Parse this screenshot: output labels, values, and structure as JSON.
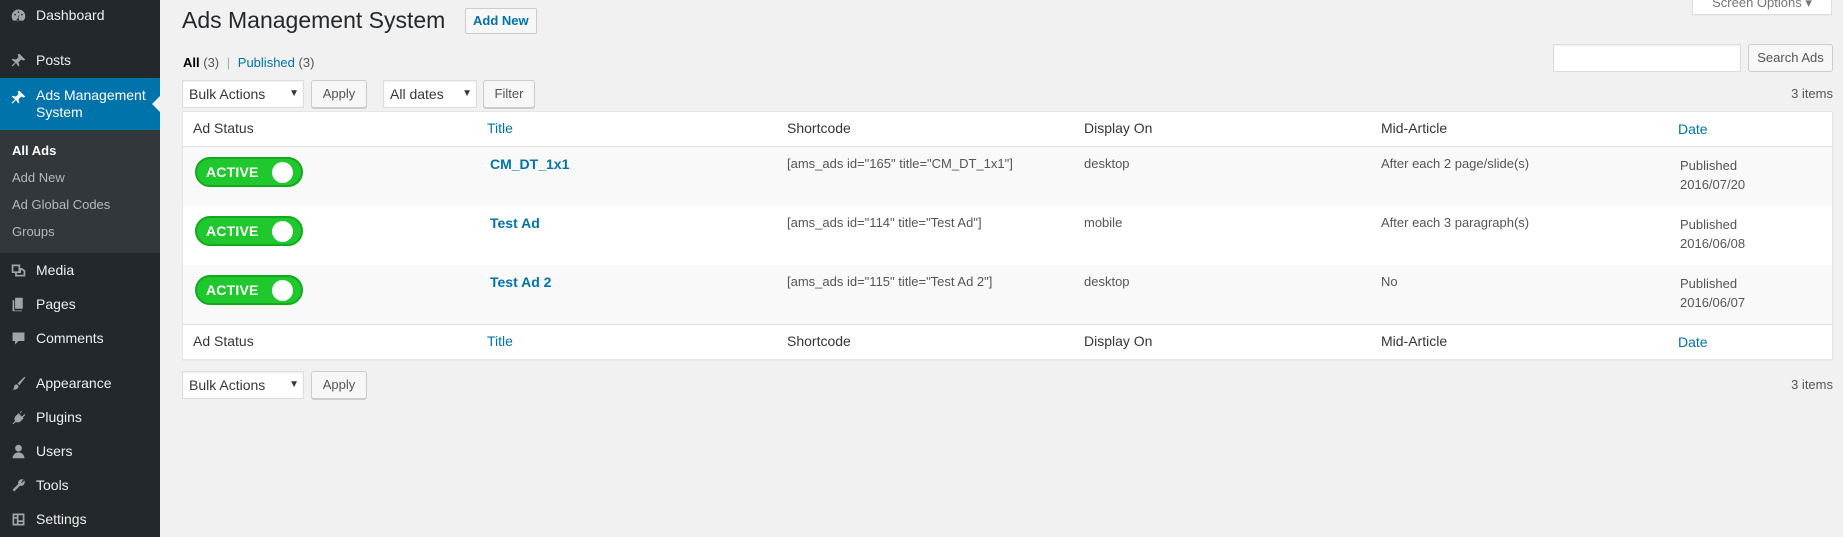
{
  "sidebar": {
    "items": [
      {
        "label": "Dashboard",
        "icon": "dashboard-icon"
      },
      {
        "label": "Posts",
        "icon": "pin-icon"
      },
      {
        "label": "Ads Management System",
        "icon": "pin-icon"
      },
      {
        "label": "Media",
        "icon": "media-icon"
      },
      {
        "label": "Pages",
        "icon": "pages-icon"
      },
      {
        "label": "Comments",
        "icon": "comment-icon"
      },
      {
        "label": "Appearance",
        "icon": "paintbrush-icon"
      },
      {
        "label": "Plugins",
        "icon": "plugin-icon"
      },
      {
        "label": "Users",
        "icon": "user-icon"
      },
      {
        "label": "Tools",
        "icon": "wrench-icon"
      },
      {
        "label": "Settings",
        "icon": "settings-icon"
      }
    ],
    "submenu": [
      "All Ads",
      "Add New",
      "Ad Global Codes",
      "Groups"
    ]
  },
  "header": {
    "title": "Ads Management System",
    "add_new": "Add New",
    "screen_options": "Screen Options ▾"
  },
  "views": {
    "all": "All",
    "all_count": "(3)",
    "separator": "|",
    "published": "Published",
    "published_count": "(3)"
  },
  "search": {
    "button": "Search Ads",
    "value": ""
  },
  "top_actions": {
    "bulk": "Bulk Actions",
    "apply": "Apply",
    "dates": "All dates",
    "filter": "Filter",
    "count": "3 items"
  },
  "bottom_actions": {
    "bulk": "Bulk Actions",
    "apply": "Apply",
    "count": "3 items"
  },
  "table": {
    "columns": [
      "Ad Status",
      "Title",
      "Shortcode",
      "Display On",
      "Mid-Article",
      "Date"
    ],
    "rows": [
      {
        "status": "ACTIVE",
        "title": "CM_DT_1x1",
        "shortcode": "[ams_ads id=\"165\" title=\"CM_DT_1x1\"]",
        "display_on": "desktop",
        "mid_article": "After each 2 page/slide(s)",
        "date_status": "Published",
        "date": "2016/07/20"
      },
      {
        "status": "ACTIVE",
        "title": "Test Ad",
        "shortcode": "[ams_ads id=\"114\" title=\"Test Ad\"]",
        "display_on": "mobile",
        "mid_article": "After each 3 paragraph(s)",
        "date_status": "Published",
        "date": "2016/06/08"
      },
      {
        "status": "ACTIVE",
        "title": "Test Ad 2",
        "shortcode": "[ams_ads id=\"115\" title=\"Test Ad 2\"]",
        "display_on": "desktop",
        "mid_article": "No",
        "date_status": "Published",
        "date": "2016/06/07"
      }
    ]
  },
  "colors": {
    "sidebar_bg": "#23282d",
    "accent": "#0073aa",
    "toggle_green": "#1fc92d",
    "page_bg": "#f1f1f1"
  }
}
